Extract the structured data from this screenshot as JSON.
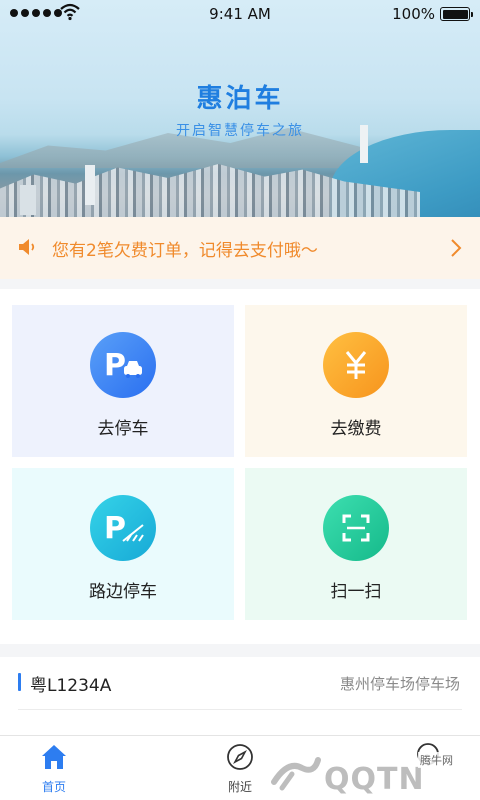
{
  "status_bar": {
    "time": "9:41 AM",
    "battery": "100%"
  },
  "banner": {
    "title": "惠泊车",
    "subtitle": "开启智慧停车之旅"
  },
  "notice": {
    "text": "您有2笔欠费订单，记得去支付哦～",
    "icon": "speaker-icon"
  },
  "actions": [
    {
      "label": "去停车",
      "icon": "parking-car-icon",
      "color": "#2a6ff0"
    },
    {
      "label": "去缴费",
      "icon": "yuan-icon",
      "color": "#f7941d"
    },
    {
      "label": "路边停车",
      "icon": "roadside-parking-icon",
      "color": "#17a9d6"
    },
    {
      "label": "扫一扫",
      "icon": "scan-icon",
      "color": "#15b98a"
    }
  ],
  "vehicle": {
    "plate": "粤L1234A",
    "lot": "惠州停车场停车场"
  },
  "tabs": [
    {
      "label": "首页",
      "icon": "home-icon",
      "active": true
    },
    {
      "label": "附近",
      "icon": "compass-icon",
      "active": false
    },
    {
      "label": "",
      "icon": "user-icon",
      "active": false
    }
  ],
  "watermark": {
    "text": "QQTN",
    "tag": "腾牛网"
  }
}
